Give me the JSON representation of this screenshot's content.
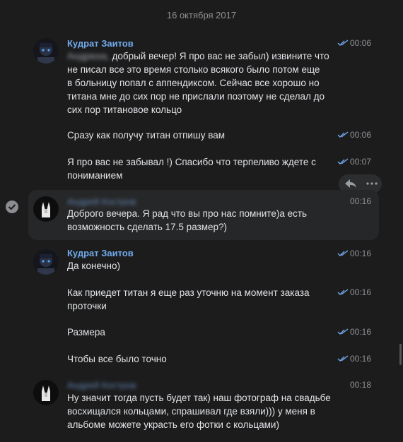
{
  "date_divider": "16 октября 2017",
  "messages": [
    {
      "sender": "Кудрат Заитов",
      "blur_prefix": "Андрюха,",
      "text": "добрый вечер! Я про вас не забыл) извините что\nне писал все это время столько всякого было потом еще\nв больницу попал с аппендиксом. Сейчас все хорошо но\nтитана мне до сих пор не прислали поэтому не сделал до\nсих пор титановое кольцо",
      "time": "00:06",
      "read": true
    },
    {
      "text": "Сразу как получу титан отпишу вам",
      "time": "00:06",
      "read": true
    },
    {
      "text": "Я про вас не забывал !) Спасибо что терпеливо ждете с\nпониманием",
      "time": "00:07",
      "read": true
    },
    {
      "sender": "Андрей Костров",
      "text": "Доброго вечера. Я рад что вы про нас помните)а есть\nвозможность сделать 17.5 размер?)",
      "time": "00:16",
      "selected": true
    },
    {
      "sender": "Кудрат Заитов",
      "text": "Да конечно)",
      "time": "00:16",
      "read": true
    },
    {
      "text": "Как приедет титан я еще раз уточню на момент заказа\nпроточки",
      "time": "00:16",
      "read": true
    },
    {
      "text": "Размера",
      "time": "00:16",
      "read": true
    },
    {
      "text": "Чтобы все было точно",
      "time": "00:16",
      "read": true
    },
    {
      "sender": "Андрей Костров",
      "text": "Ну значит тогда пусть будет так) наш фотограф на свадьбе\nвосхищался кольцами, спрашивал где взяли))) у меня в\nальбоме можете украсть его фотки с кольцами)",
      "time": "00:18"
    }
  ],
  "icons": {
    "read_ticks": "double-check-icon",
    "reply": "reply-icon",
    "more": "more-icon",
    "select": "checkmark-icon"
  },
  "colors": {
    "background": "#1c1c1d",
    "sender_name": "#71aaeb",
    "ticks": "#71aaeb",
    "muted": "#8f9194"
  }
}
